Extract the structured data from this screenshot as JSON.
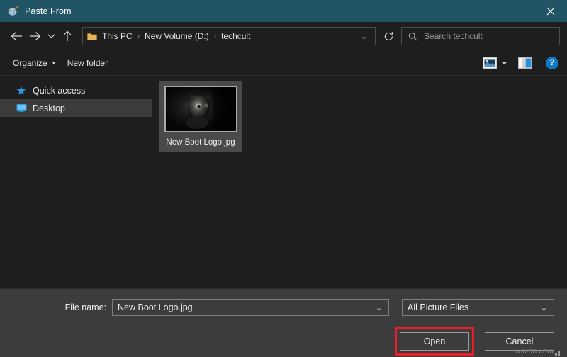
{
  "window": {
    "title": "Paste From",
    "title_icon": "paint-app-icon",
    "close_label": "✕"
  },
  "nav": {
    "back_icon": "arrow-left-icon",
    "forward_icon": "arrow-right-icon",
    "recent_icon": "chevron-down-icon",
    "up_icon": "arrow-up-icon",
    "refresh_icon": "refresh-icon",
    "address_folder_icon": "folder-icon",
    "breadcrumbs": [
      "This PC",
      "New Volume (D:)",
      "techcult"
    ],
    "breadcrumb_separator": "›",
    "address_chevron": "⌄"
  },
  "search": {
    "icon": "search-icon",
    "placeholder": "Search techcult"
  },
  "toolbar": {
    "organize_label": "Organize",
    "new_folder_label": "New folder",
    "view_icon": "picture-view-icon",
    "view_caret_icon": "chevron-down-icon",
    "preview_pane_icon": "preview-pane-icon",
    "help_label": "?"
  },
  "sidebar": {
    "items": [
      {
        "label": "Quick access",
        "icon": "star-icon",
        "selected": false
      },
      {
        "label": "Desktop",
        "icon": "monitor-icon",
        "selected": true
      }
    ]
  },
  "files": {
    "items": [
      {
        "name": "New Boot Logo.jpg",
        "thumbnail": "dark-animal-photo-thumbnail",
        "selected": true
      }
    ]
  },
  "footer": {
    "filename_label": "File name:",
    "filename_value": "New Boot Logo.jpg",
    "filename_chevron": "⌄",
    "filetype_value": "All Picture Files",
    "filetype_chevron": "⌄",
    "open_label": "Open",
    "cancel_label": "Cancel",
    "highlight_color": "#ee1c25"
  },
  "watermark": {
    "text": "wsxdn.com"
  }
}
